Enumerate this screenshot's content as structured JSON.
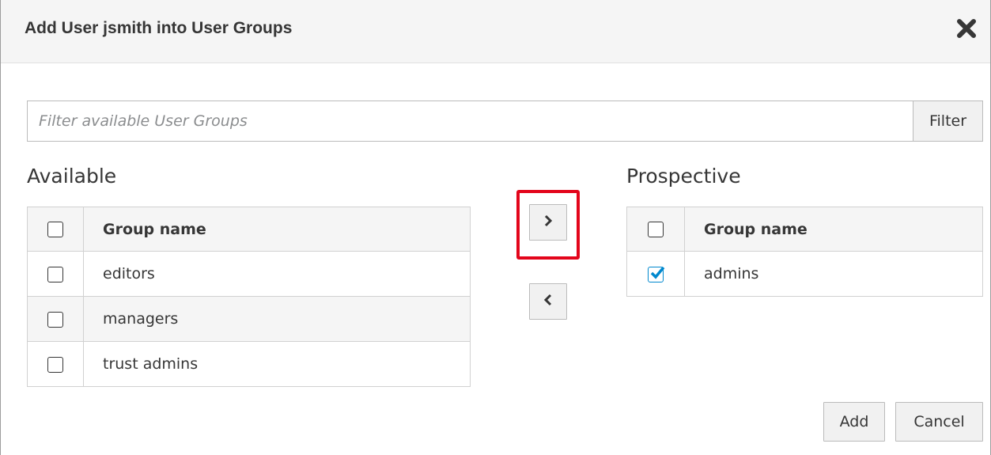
{
  "dialog": {
    "title": "Add User jsmith into User Groups",
    "close_icon": "close-icon"
  },
  "filter": {
    "placeholder": "Filter available User Groups",
    "value": "",
    "button_label": "Filter"
  },
  "available": {
    "label": "Available",
    "column_header": "Group name",
    "rows": [
      {
        "name": "editors",
        "checked": false
      },
      {
        "name": "managers",
        "checked": false
      },
      {
        "name": "trust admins",
        "checked": false
      }
    ]
  },
  "prospective": {
    "label": "Prospective",
    "column_header": "Group name",
    "rows": [
      {
        "name": "admins",
        "checked": true
      }
    ]
  },
  "move_buttons": {
    "add_icon": "chevron-right-icon",
    "remove_icon": "chevron-left-icon"
  },
  "footer": {
    "add_label": "Add",
    "cancel_label": "Cancel"
  },
  "colors": {
    "highlight": "#e3051b",
    "checkbox_checked": "#0088ce"
  }
}
